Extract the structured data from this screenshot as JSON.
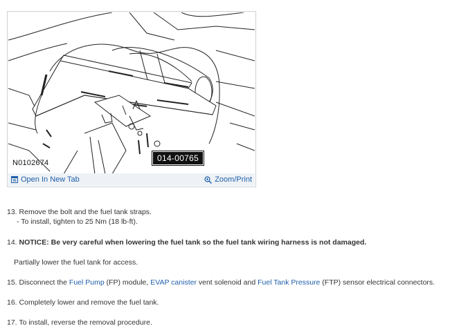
{
  "figure": {
    "code": "N0102674",
    "tag": "014-00765",
    "open_label": "Open In New Tab",
    "zoom_label": "Zoom/Print"
  },
  "steps": [
    {
      "num": "13.",
      "text": "Remove the bolt and the fuel tank straps."
    },
    {
      "sub": "-  To install, tighten to 25 Nm (18 lb-ft)."
    },
    {
      "num": "14.",
      "bold": "NOTICE: Be very careful when lowering the fuel tank so the fuel tank wiring harness is not damaged."
    },
    {
      "indent": "Partially lower the fuel tank for access."
    },
    {
      "num": "15.",
      "pre": "Disconnect the ",
      "link1": "Fuel Pump",
      "mid1": " (FP) module, ",
      "link2": "EVAP canister",
      "mid2": " vent solenoid and ",
      "link3": "Fuel Tank Pressure",
      "post": " (FTP) sensor electrical connectors."
    },
    {
      "num": "16.",
      "text": "Completely lower and remove the fuel tank."
    },
    {
      "num": "17.",
      "text": "To install, reverse the removal procedure."
    }
  ],
  "colors": {
    "link": "#1f5ea8",
    "bar": "#eef2f6",
    "text": "#333333"
  }
}
